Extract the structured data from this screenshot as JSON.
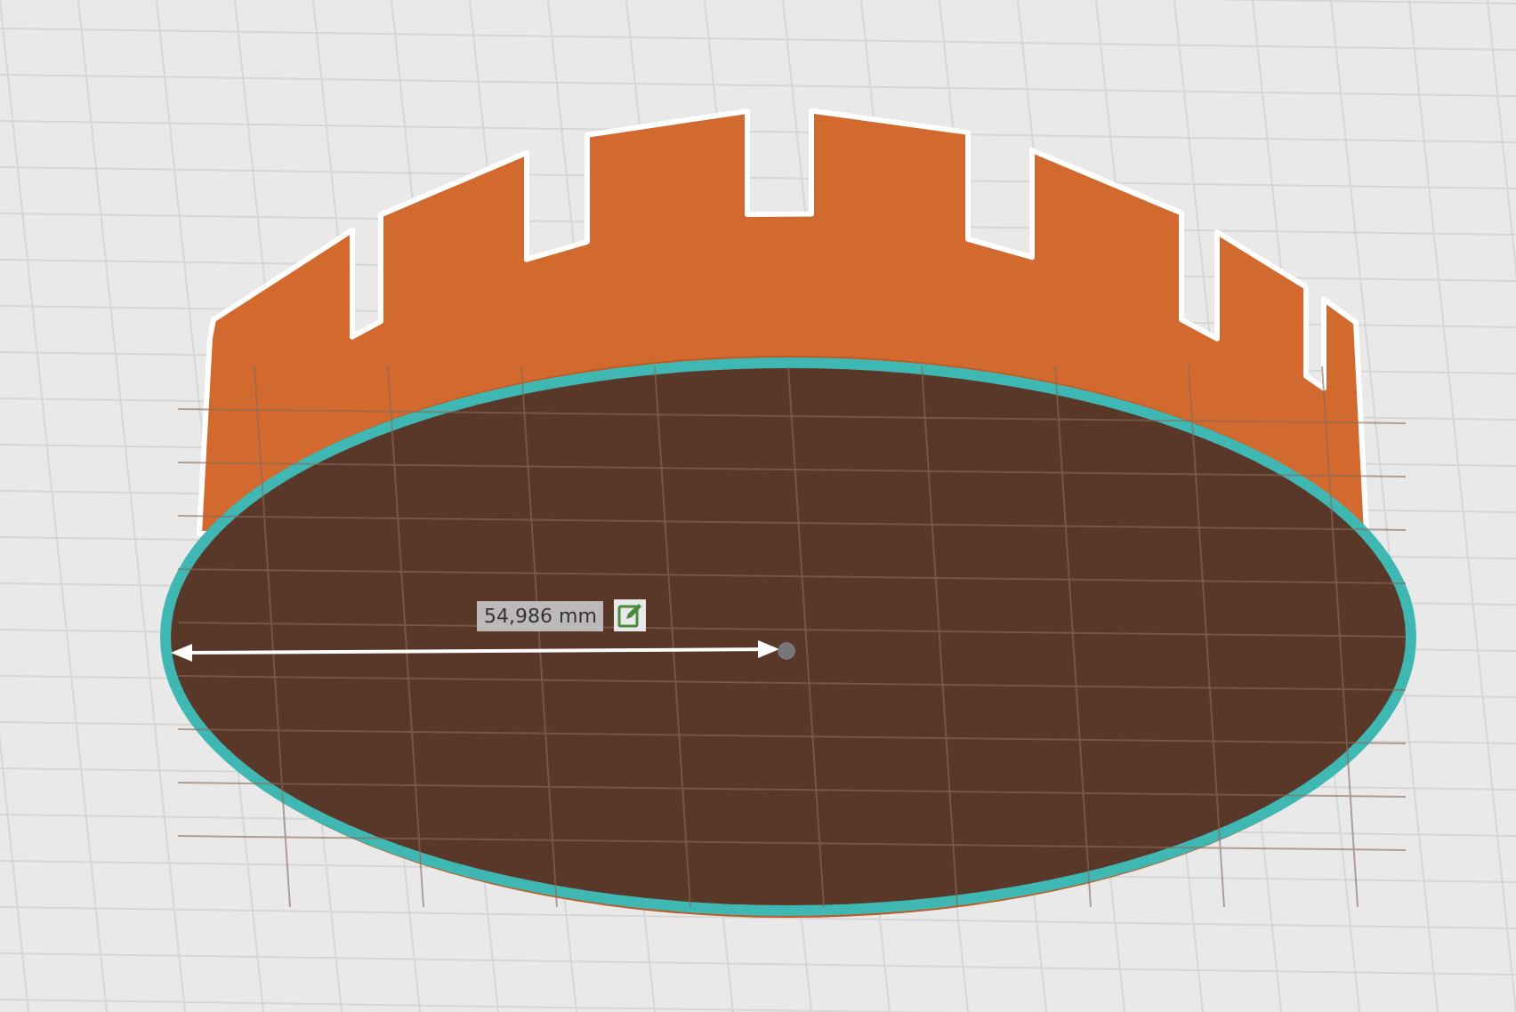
{
  "viewport": {
    "dimension": {
      "value": "54,986 mm"
    }
  }
}
